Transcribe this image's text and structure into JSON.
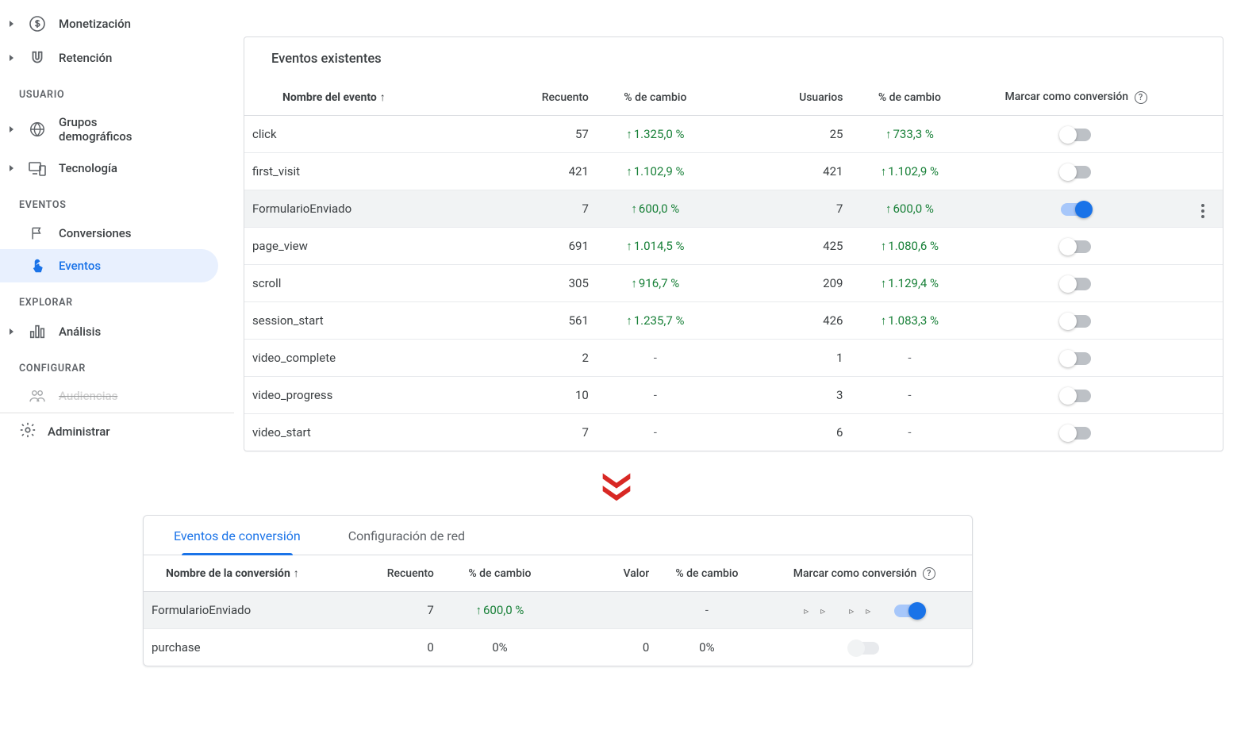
{
  "sidebar": {
    "top": [
      {
        "label": "Monetización",
        "icon": "dollar"
      },
      {
        "label": "Retención",
        "icon": "magnet"
      }
    ],
    "user_header": "USUARIO",
    "user_items": [
      {
        "label": "Grupos demográficos",
        "icon": "globe"
      },
      {
        "label": "Tecnología",
        "icon": "devices"
      }
    ],
    "events_header": "EVENTOS",
    "events_items": [
      {
        "label": "Conversiones",
        "icon": "flag"
      },
      {
        "label": "Eventos",
        "icon": "touch"
      }
    ],
    "explore_header": "EXPLORAR",
    "explore_items": [
      {
        "label": "Análisis",
        "icon": "chart"
      }
    ],
    "config_header": "CONFIGURAR",
    "config_items": [
      {
        "label": "Audiencias",
        "icon": "people"
      }
    ],
    "admin_label": "Administrar"
  },
  "events": {
    "title": "Eventos existentes",
    "columns": {
      "name": "Nombre del evento",
      "count": "Recuento",
      "change1": "% de cambio",
      "users": "Usuarios",
      "change2": "% de cambio",
      "conversion": "Marcar como conversión"
    },
    "rows": [
      {
        "name": "click",
        "count": "57",
        "change1": "1.325,0 %",
        "users": "25",
        "change2": "733,3 %",
        "on": false,
        "hover": false
      },
      {
        "name": "first_visit",
        "count": "421",
        "change1": "1.102,9 %",
        "users": "421",
        "change2": "1.102,9 %",
        "on": false,
        "hover": false
      },
      {
        "name": "FormularioEnviado",
        "count": "7",
        "change1": "600,0 %",
        "users": "7",
        "change2": "600,0 %",
        "on": true,
        "hover": true
      },
      {
        "name": "page_view",
        "count": "691",
        "change1": "1.014,5 %",
        "users": "425",
        "change2": "1.080,6 %",
        "on": false,
        "hover": false
      },
      {
        "name": "scroll",
        "count": "305",
        "change1": "916,7 %",
        "users": "209",
        "change2": "1.129,4 %",
        "on": false,
        "hover": false
      },
      {
        "name": "session_start",
        "count": "561",
        "change1": "1.235,7 %",
        "users": "426",
        "change2": "1.083,3 %",
        "on": false,
        "hover": false
      },
      {
        "name": "video_complete",
        "count": "2",
        "change1": "",
        "users": "1",
        "change2": "",
        "on": false,
        "hover": false
      },
      {
        "name": "video_progress",
        "count": "10",
        "change1": "",
        "users": "3",
        "change2": "",
        "on": false,
        "hover": false
      },
      {
        "name": "video_start",
        "count": "7",
        "change1": "",
        "users": "6",
        "change2": "",
        "on": false,
        "hover": false
      }
    ]
  },
  "conversions": {
    "tab1": "Eventos de conversión",
    "tab2": "Configuración de red",
    "columns": {
      "name": "Nombre de la conversión",
      "count": "Recuento",
      "change1": "% de cambio",
      "value": "Valor",
      "change2": "% de cambio",
      "conversion": "Marcar como conversión"
    },
    "rows": [
      {
        "name": "FormularioEnviado",
        "count": "7",
        "change1": "600,0 %",
        "change1up": true,
        "value": "",
        "change2": "-",
        "on": true,
        "disabled": false,
        "hover": true
      },
      {
        "name": "purchase",
        "count": "0",
        "change1": "0%",
        "change1up": false,
        "value": "0",
        "change2": "0%",
        "on": true,
        "disabled": true,
        "hover": false
      }
    ]
  }
}
